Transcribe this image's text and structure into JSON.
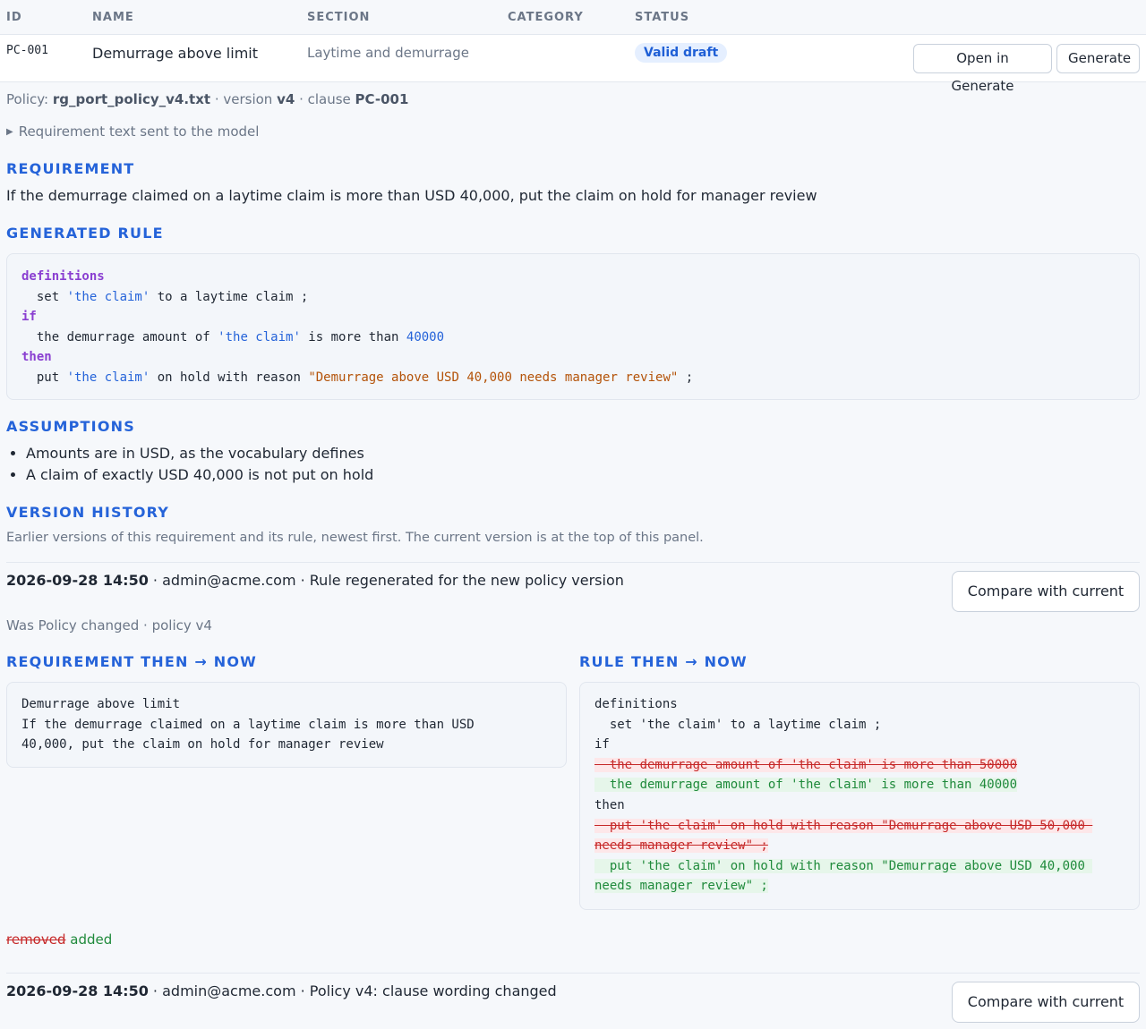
{
  "table": {
    "headers": {
      "id": "ID",
      "name": "NAME",
      "section": "SECTION",
      "category": "CATEGORY",
      "status": "STATUS"
    },
    "row": {
      "id": "PC-001",
      "name": "Demurrage above limit",
      "section": "Laytime and demurrage",
      "category": "",
      "status": "Valid draft",
      "open_button": "Open in Generate",
      "generate_button": "Generate"
    }
  },
  "meta": {
    "policy_label": "Policy: ",
    "policy_file": "rg_port_policy_v4.txt",
    "sep1": " · version ",
    "version": "v4",
    "sep2": " · clause ",
    "clause": "PC-001"
  },
  "details_summary": "Requirement text sent to the model",
  "requirement": {
    "heading": "REQUIREMENT",
    "text": "If the demurrage claimed on a laytime claim is more than USD 40,000, put the claim on hold for manager review"
  },
  "generated_rule": {
    "heading": "GENERATED RULE",
    "lines": {
      "kw_definitions": "definitions",
      "l2a": "  set ",
      "l2b": "'the claim'",
      "l2c": " to a laytime claim ;",
      "kw_if": "if",
      "l4a": "  the demurrage amount of ",
      "l4b": "'the claim'",
      "l4c": " is more than ",
      "l4d": "40000",
      "kw_then": "then",
      "l6a": "  put ",
      "l6b": "'the claim'",
      "l6c": " on hold with reason ",
      "l6d": "\"Demurrage above USD 40,000 needs manager review\"",
      "l6e": " ;"
    }
  },
  "assumptions": {
    "heading": "ASSUMPTIONS",
    "items": [
      "Amounts are in USD, as the vocabulary defines",
      "A claim of exactly USD 40,000 is not put on hold"
    ]
  },
  "version_history": {
    "heading": "VERSION HISTORY",
    "description": "Earlier versions of this requirement and its rule, newest first. The current version is at the top of this panel.",
    "entries": [
      {
        "timestamp": "2026-09-28 14:50",
        "rest": " · admin@acme.com · Rule regenerated for the new policy version",
        "compare_button": "Compare with current",
        "sub_meta": "Was Policy changed · policy v4",
        "req_heading": "REQUIREMENT THEN → NOW",
        "rule_heading": "RULE THEN → NOW",
        "req_then": "Demurrage above limit\nIf the demurrage claimed on a laytime claim is more than USD\n40,000, put the claim on hold for manager review",
        "rule_diff": {
          "c1": "definitions",
          "c2": "  set 'the claim' to a laytime claim ;",
          "c3": "if",
          "d1": "  the demurrage amount of 'the claim' is more than 50000",
          "a1": "  the demurrage amount of 'the claim' is more than 40000",
          "c4": "then",
          "d2a": "  put 'the claim' on hold with reason \"Demurrage above USD 50,000 ",
          "d2b": "needs manager review\" ;",
          "a2a": "  put 'the claim' on hold with reason \"Demurrage above USD 40,000 ",
          "a2b": "needs manager review\" ;"
        },
        "legend_removed": "removed",
        "legend_added": "added"
      },
      {
        "timestamp": "2026-09-28 14:50",
        "rest": " · admin@acme.com · Policy v4: clause wording changed",
        "compare_button": "Compare with current"
      }
    ]
  }
}
